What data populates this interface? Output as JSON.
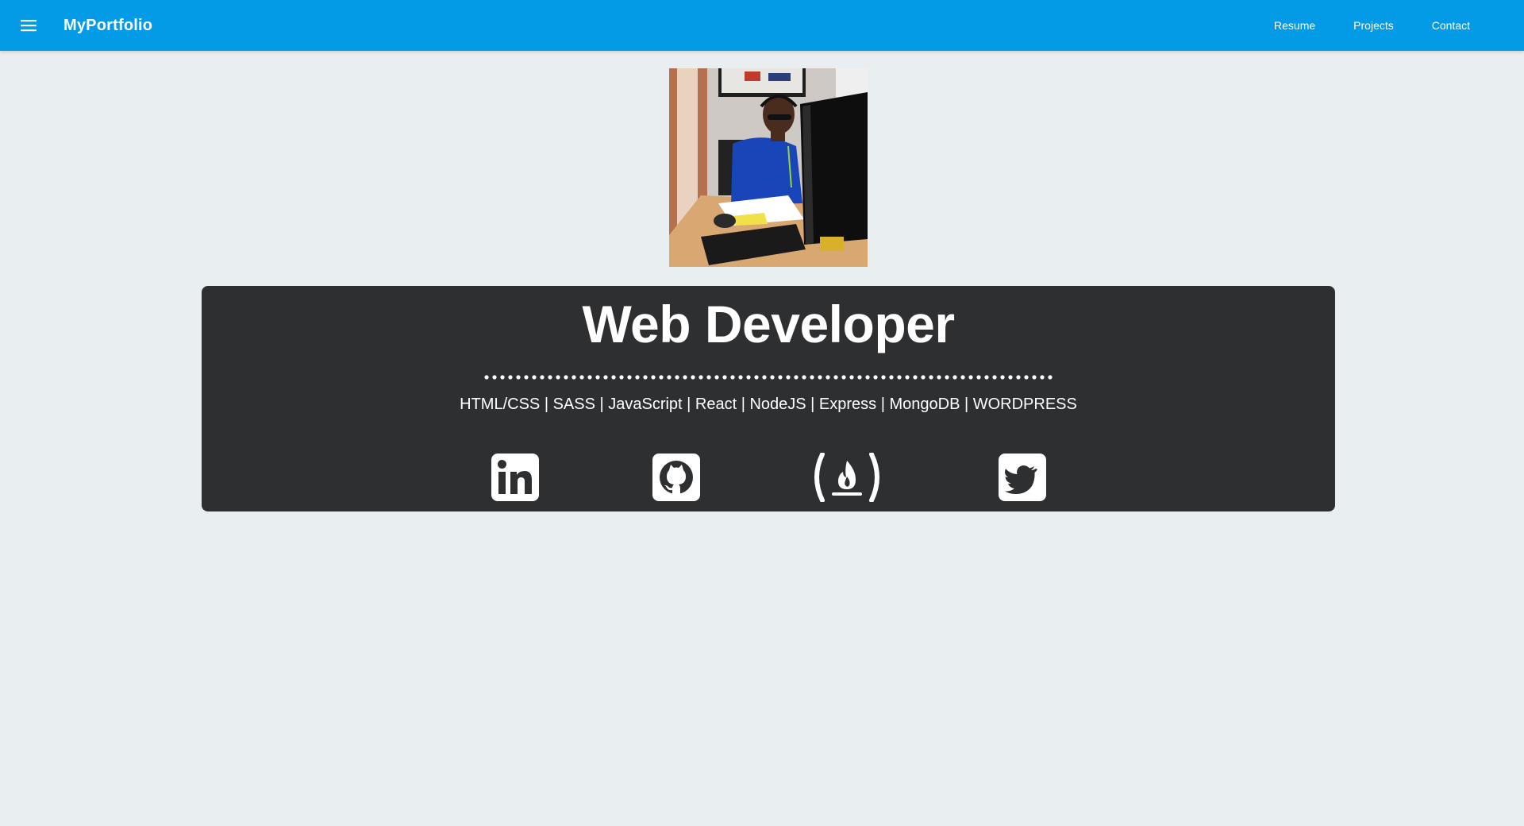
{
  "header": {
    "menu_icon": "hamburger-menu-icon",
    "brand": "MyPortfolio",
    "nav": [
      {
        "label": "Resume"
      },
      {
        "label": "Projects"
      },
      {
        "label": "Contact"
      }
    ],
    "background_color": "#039be5"
  },
  "profile": {
    "image": "profile-photo"
  },
  "hero": {
    "title": "Web Developer",
    "skills": "HTML/CSS | SASS | JavaScript | React | NodeJS | Express | MongoDB | WORDPRESS",
    "background_color": "#2e2f31",
    "social_icons": [
      "linkedin-icon",
      "github-icon",
      "freecodecamp-icon",
      "twitter-icon"
    ]
  }
}
